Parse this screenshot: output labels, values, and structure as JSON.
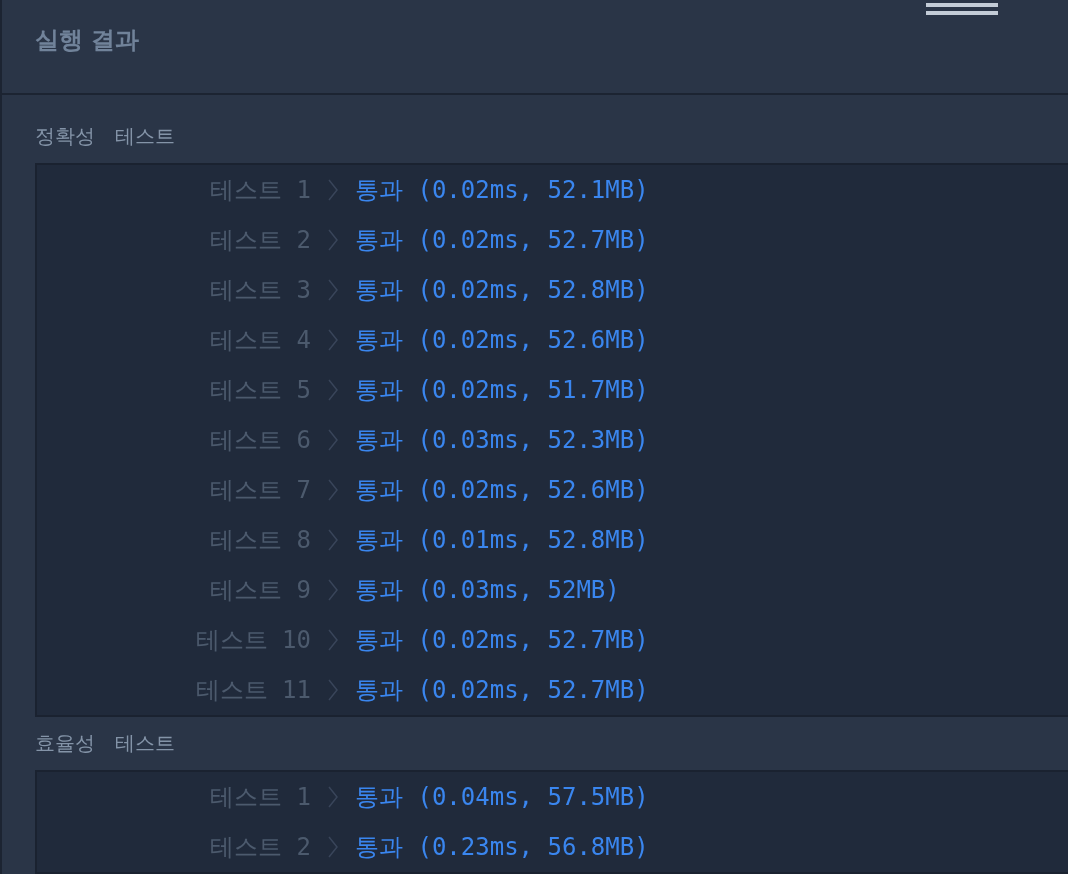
{
  "title": "실행 결과",
  "sections": [
    {
      "label": "정확성 테스트",
      "tests": [
        {
          "label": "테스트 1",
          "result": "통과 (0.02ms, 52.1MB)"
        },
        {
          "label": "테스트 2",
          "result": "통과 (0.02ms, 52.7MB)"
        },
        {
          "label": "테스트 3",
          "result": "통과 (0.02ms, 52.8MB)"
        },
        {
          "label": "테스트 4",
          "result": "통과 (0.02ms, 52.6MB)"
        },
        {
          "label": "테스트 5",
          "result": "통과 (0.02ms, 51.7MB)"
        },
        {
          "label": "테스트 6",
          "result": "통과 (0.03ms, 52.3MB)"
        },
        {
          "label": "테스트 7",
          "result": "통과 (0.02ms, 52.6MB)"
        },
        {
          "label": "테스트 8",
          "result": "통과 (0.01ms, 52.8MB)"
        },
        {
          "label": "테스트 9",
          "result": "통과 (0.03ms, 52MB)"
        },
        {
          "label": "테스트 10",
          "result": "통과 (0.02ms, 52.7MB)"
        },
        {
          "label": "테스트 11",
          "result": "통과 (0.02ms, 52.7MB)"
        }
      ]
    },
    {
      "label": "효율성 테스트",
      "tests": [
        {
          "label": "테스트 1",
          "result": "통과 (0.04ms, 57.5MB)"
        },
        {
          "label": "테스트 2",
          "result": "통과 (0.23ms, 56.8MB)"
        }
      ]
    }
  ]
}
